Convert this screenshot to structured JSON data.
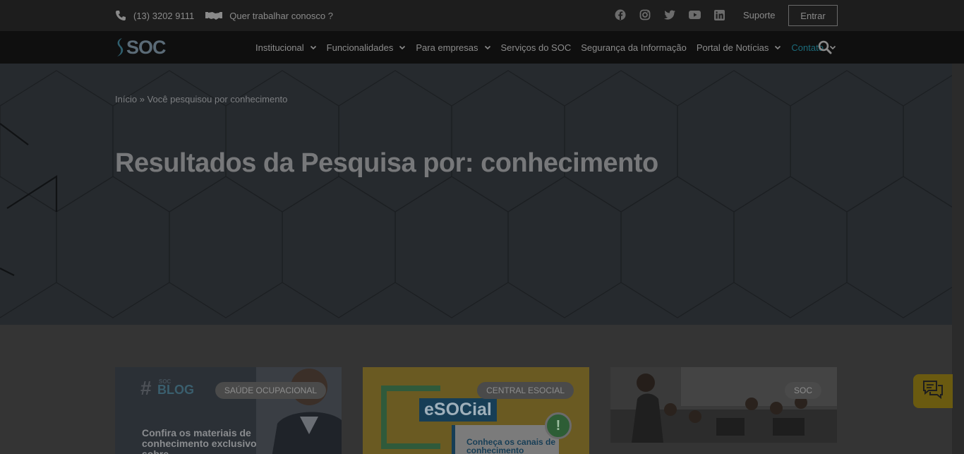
{
  "topbar": {
    "phone": "(13) 3202 9111",
    "careers": "Quer trabalhar conosco ?",
    "social": [
      "facebook-icon",
      "instagram-icon",
      "twitter-icon",
      "youtube-icon",
      "linkedin-icon"
    ],
    "support": "Suporte",
    "login": "Entrar"
  },
  "nav": {
    "logo": "SOC",
    "items": [
      {
        "label": "Institucional",
        "dropdown": true
      },
      {
        "label": "Funcionalidades",
        "dropdown": true
      },
      {
        "label": "Para empresas",
        "dropdown": true
      },
      {
        "label": "Serviços do SOC",
        "dropdown": false
      },
      {
        "label": "Segurança da Informação",
        "dropdown": false
      },
      {
        "label": "Portal de Notícias",
        "dropdown": true
      },
      {
        "label": "Contato",
        "dropdown": true
      }
    ],
    "search_icon": "search-icon",
    "active_color": "#1b6b7a"
  },
  "hero": {
    "breadcrumb_home": "Início",
    "breadcrumb_sep": "»",
    "breadcrumb_current": "Você pesquisou por conhecimento",
    "title": "Resultados da Pesquisa por: conhecimento"
  },
  "cards": [
    {
      "badge": "SAÚDE OCUPACIONAL",
      "hash": "#",
      "tag": "BLOG",
      "small": "SOC",
      "text": "Confira os materiais de conhecimento exclusivo sobre"
    },
    {
      "badge": "CENTRAL ESOCIAL",
      "brand": "eSOCial",
      "text": "Conheça os canais de conhecimento",
      "alert": "!"
    },
    {
      "badge": "SOC"
    }
  ],
  "chat": {
    "icon": "chat-icon"
  }
}
